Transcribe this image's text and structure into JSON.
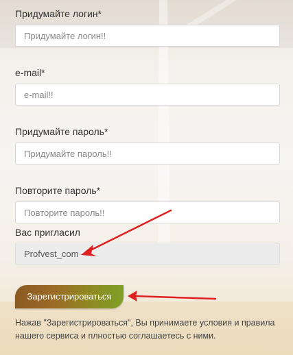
{
  "login": {
    "label": "Придумайте логин*",
    "placeholder": "Придумайте логин!!"
  },
  "email": {
    "label": "e-mail*",
    "placeholder": "e-mail!!"
  },
  "password": {
    "label": "Придумайте пароль*",
    "placeholder": "Придумайте пароль!!"
  },
  "password_repeat": {
    "label": "Повторите пароль*",
    "placeholder": "Повторите пароль!!"
  },
  "referrer": {
    "label": "Вас пригласил",
    "value": "Profvest_com"
  },
  "register_button": {
    "label": "Зарегистрироваться"
  },
  "terms_text": "Нажав \"Зарегистрироваться\", Вы принимаете условия и правила нашего сервиса и плностью соглашаетесь с ними.",
  "colors": {
    "button_start": "#8a5a22",
    "button_end": "#7fa027",
    "annotation_arrow": "#e02020"
  }
}
